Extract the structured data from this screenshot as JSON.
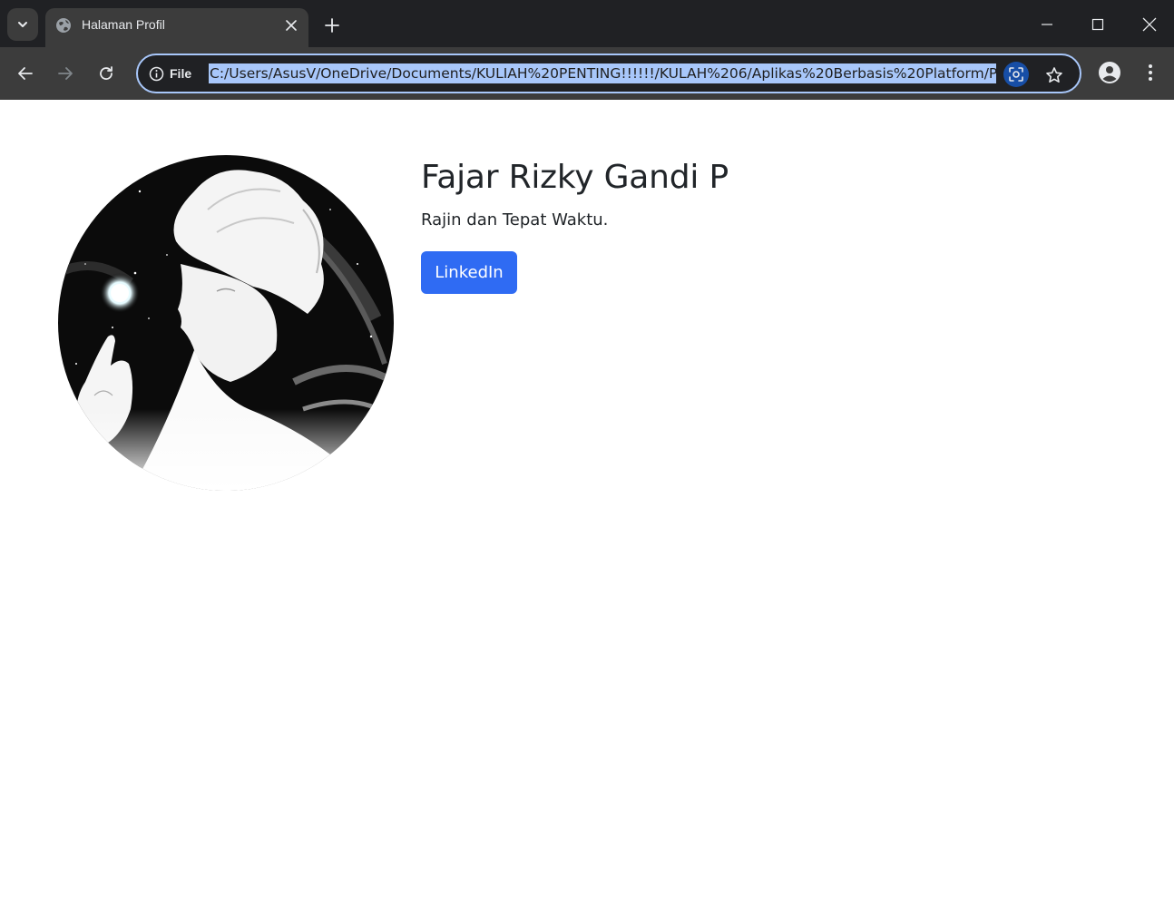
{
  "browser": {
    "tab": {
      "title": "Halaman Profil",
      "favicon": "globe-icon"
    },
    "omnibox": {
      "site_label": "File",
      "url": "C:/Users/AsusV/OneDrive/Documents/KULIAH%20PENTING!!!!!!/KULAH%206/Aplikas%20Berbasis%20Platform/P"
    },
    "colors": {
      "frame": "#202124",
      "toolbar": "#3c3c3c",
      "omnibox_border": "#a8c7fa",
      "url_selection": "#a8c7fa"
    }
  },
  "profile": {
    "name": "Fajar Rizky Gandi P",
    "tagline": "Rajin dan Tepat Waktu.",
    "button_label": "LinkedIn",
    "avatar_icon": "anime-portrait-avatar",
    "colors": {
      "button": "#2f6bf3",
      "text": "#212529"
    }
  }
}
